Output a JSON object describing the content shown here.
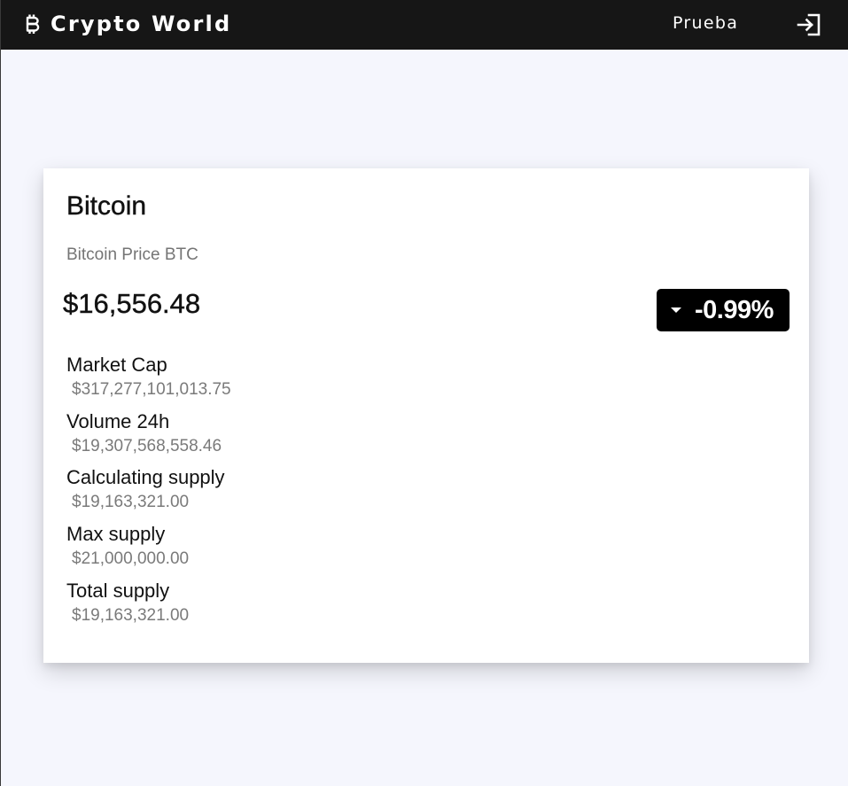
{
  "header": {
    "brand_icon": "bitcoin-icon",
    "title": "Crypto World",
    "user_name": "Prueba",
    "logout_icon": "logout-icon"
  },
  "coin": {
    "name": "Bitcoin",
    "subtitle": "Bitcoin Price BTC",
    "price": "$16,556.48",
    "change": "-0.99%",
    "change_direction_icon": "caret-down-icon",
    "stats": [
      {
        "label": "Market Cap",
        "value": "$317,277,101,013.75"
      },
      {
        "label": "Volume 24h",
        "value": "$19,307,568,558.46"
      },
      {
        "label": "Calculating supply",
        "value": "$19,163,321.00"
      },
      {
        "label": "Max supply",
        "value": "$21,000,000.00"
      },
      {
        "label": "Total supply",
        "value": "$19,163,321.00"
      }
    ]
  },
  "colors": {
    "header_bg": "#161616",
    "page_bg": "#f5f6fd",
    "card_bg": "#ffffff",
    "badge_bg": "#000000",
    "muted_text": "#757575"
  }
}
